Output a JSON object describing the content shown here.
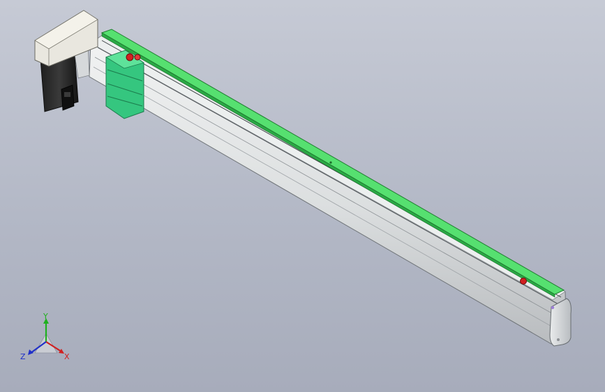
{
  "viewport": {
    "background_top": "#c6cad5",
    "background_bottom": "#a7acbb"
  },
  "model": {
    "parts": [
      "linear-actuator-body",
      "green-belt-cover",
      "carriage-slider",
      "servo-motor",
      "motor-connector-box",
      "end-cap",
      "limit-sensor-red"
    ],
    "colors": {
      "body": "#dfe2e4",
      "cover": "#3fd05a",
      "carriage": "#2fc07a",
      "motor": "#2a2a2a",
      "connector_box": "#e6e4dc",
      "sensor": "#d22020"
    }
  },
  "triad": {
    "x_label": "X",
    "y_label": "Y",
    "z_label": "Z",
    "x_color": "#d02020",
    "y_color": "#20b020",
    "z_color": "#2030c8"
  }
}
